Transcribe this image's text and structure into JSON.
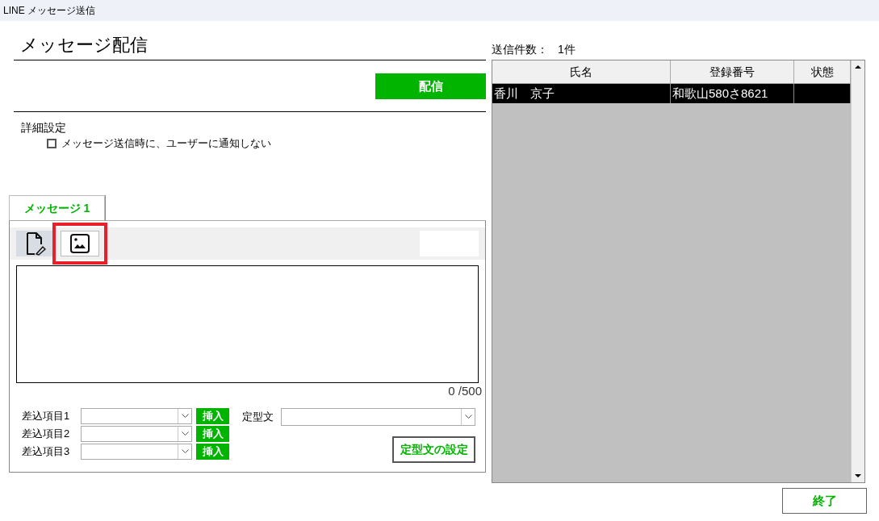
{
  "window": {
    "title": "LINE メッセージ送信"
  },
  "heading": "メッセージ配信",
  "send_button": "配信",
  "settings": {
    "label": "詳細設定",
    "options": [
      {
        "label": "メッセージ送信時に、ユーザーに通知しない",
        "checked": false
      }
    ]
  },
  "tabs": [
    {
      "label": "メッセージ 1",
      "selected": true
    }
  ],
  "editor": {
    "tools": [
      {
        "kind": "text",
        "selected": true,
        "highlighted": false
      },
      {
        "kind": "image",
        "selected": false,
        "highlighted": true
      }
    ],
    "counter": "0 /500"
  },
  "merge_fields": [
    {
      "label": "差込項目1",
      "button": "挿入"
    },
    {
      "label": "差込項目2",
      "button": "挿入"
    },
    {
      "label": "差込項目3",
      "button": "挿入"
    }
  ],
  "template": {
    "label": "定型文",
    "button": "定型文の設定"
  },
  "recipients": {
    "count_label": "送信件数：",
    "count": "1件",
    "columns": [
      "氏名",
      "登録番号",
      "状態"
    ],
    "rows": [
      {
        "name": "香川　京子",
        "number": "和歌山580さ8621",
        "selected": true
      }
    ]
  },
  "close_button": "終了"
}
